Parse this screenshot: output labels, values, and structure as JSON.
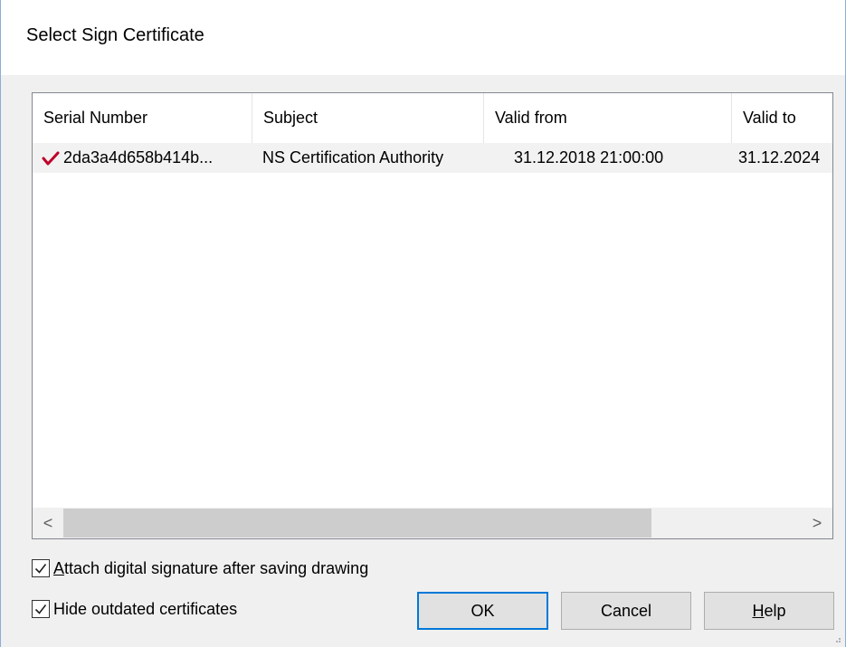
{
  "window": {
    "title": "Select Sign Certificate"
  },
  "list": {
    "columns": [
      {
        "label": "Serial Number"
      },
      {
        "label": "Subject"
      },
      {
        "label": "Valid from"
      },
      {
        "label": "Valid to"
      }
    ],
    "rows": [
      {
        "status_icon": "red-check-icon",
        "serial": "2da3a4d658b414b...",
        "subject": "NS Certification Authority",
        "valid_from": "31.12.2018 21:00:00",
        "valid_to": "31.12.2024"
      }
    ],
    "scroll_left_glyph": "<",
    "scroll_right_glyph": ">"
  },
  "options": {
    "attach_signature": {
      "label_underline": "A",
      "label_rest": "ttach digital signature after saving drawing",
      "checked": true
    },
    "hide_outdated": {
      "label": "Hide outdated certificates",
      "checked": true
    }
  },
  "buttons": {
    "ok": "OK",
    "cancel": "Cancel",
    "help_underline": "H",
    "help_rest": "elp"
  },
  "colors": {
    "accent": "#0078d7",
    "check": "#c0002a"
  }
}
